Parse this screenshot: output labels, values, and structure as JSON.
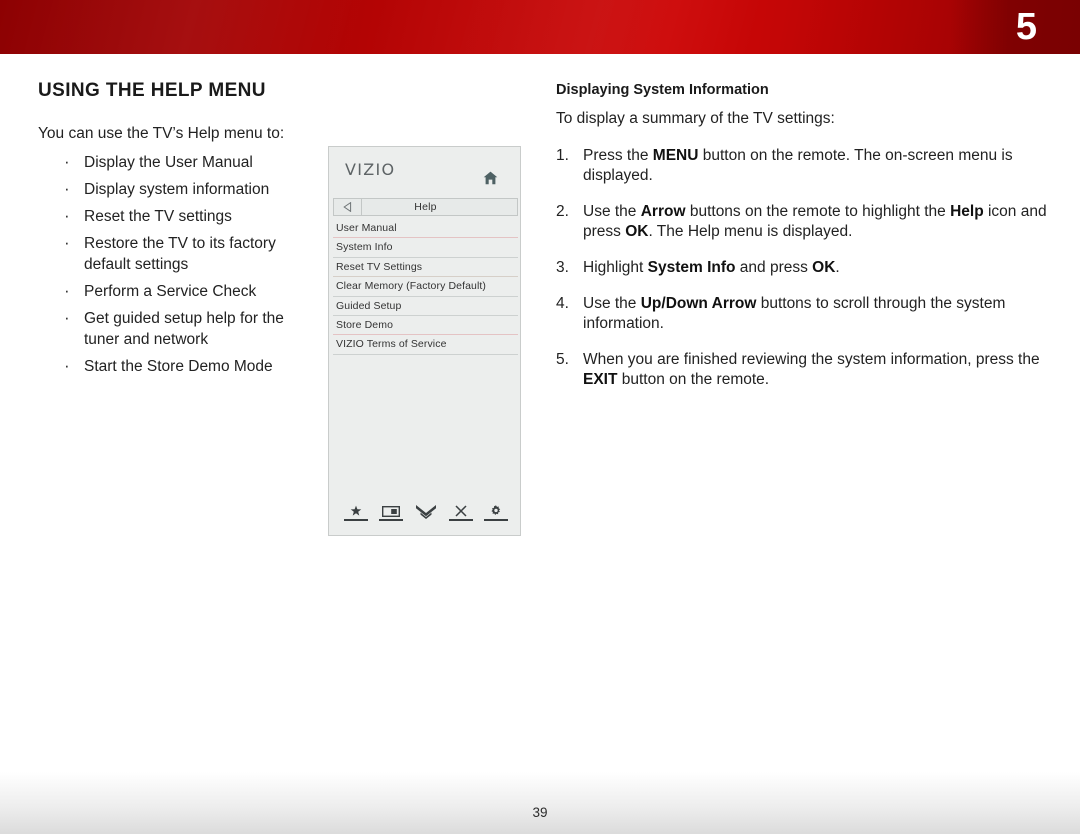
{
  "banner": {
    "chapter_number": "5"
  },
  "left": {
    "section_title": "USING THE HELP MENU",
    "lead": "You can use the TV’s Help menu to:",
    "bullets": [
      "Display the User Manual",
      "Display system information",
      "Reset the TV settings",
      "Restore the TV to its factory default settings",
      "Perform a Service Check",
      "Get guided setup help for the tuner and network",
      "Start the Store Demo Mode"
    ]
  },
  "tv_menu": {
    "brand": "VIZIO",
    "home_icon": "home-icon",
    "back_icon": "back-arrow-icon",
    "breadcrumb_label": "Help",
    "items": [
      "User Manual",
      "System Info",
      "Reset TV Settings",
      "Clear Memory (Factory Default)",
      "Guided Setup",
      "Store Demo",
      "VIZIO Terms of Service"
    ],
    "bottom_icons": [
      "star-icon",
      "picture-in-picture-icon",
      "double-chevron-down-icon",
      "close-x-icon",
      "gear-icon"
    ]
  },
  "right": {
    "sub_title": "Displaying System Information",
    "intro": "To display a summary of the TV settings:",
    "steps": [
      {
        "num": "1.",
        "html": "Press the <b>MENU</b> button on the remote. The on-screen menu is displayed."
      },
      {
        "num": "2.",
        "html": "Use the <b>Arrow</b> buttons on the remote to highlight the <b>Help</b> icon and press <b>OK</b>. The Help menu is displayed."
      },
      {
        "num": "3.",
        "html": "Highlight <b>System Info</b> and press <b>OK</b>."
      },
      {
        "num": "4.",
        "html": "Use the <b>Up/Down Arrow</b> buttons to scroll through the system information."
      },
      {
        "num": "5.",
        "html": "When you are finished reviewing the system information, press the <b>EXIT</b> button on the remote."
      }
    ]
  },
  "footer": {
    "page_number": "39"
  },
  "colors": {
    "banner_dark": "#8d0102",
    "banner_bright": "#cd0606",
    "panel_bg": "#eceeed",
    "panel_border": "#c9cccb",
    "text": "#222222",
    "icon_dark": "#3b4042",
    "home_icon": "#4e6164"
  }
}
